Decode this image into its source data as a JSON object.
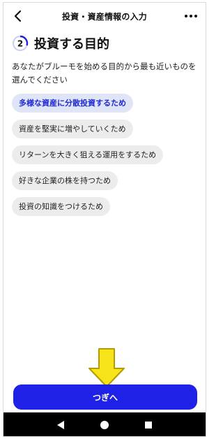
{
  "header": {
    "title": "投資・資産情報の入力"
  },
  "step": {
    "number": "2",
    "title": "投資する目的"
  },
  "description": "あなたがブルーモを始める目的から最も近いものを選んでください",
  "options": [
    {
      "label": "多様な資産に分散投資するため",
      "selected": true
    },
    {
      "label": "資産を堅実に増やしていくため",
      "selected": false
    },
    {
      "label": "リターンを大きく狙える運用をするため",
      "selected": false
    },
    {
      "label": "好きな企業の株を持つため",
      "selected": false
    },
    {
      "label": "投資の知識をつけるため",
      "selected": false
    }
  ],
  "next_button": {
    "label": "つぎへ"
  },
  "colors": {
    "accent": "#1f22e6",
    "selected_chip_bg": "#dfe4f7",
    "chip_bg": "#ececec",
    "arrow_fill": "#f7e31a",
    "arrow_stroke": "#b59a00"
  },
  "icons": {
    "back": "chevron-left-icon",
    "menu": "more-horizontal-icon",
    "nav_back": "triangle-back-icon",
    "nav_home": "circle-home-icon",
    "nav_recents": "square-recents-icon"
  }
}
